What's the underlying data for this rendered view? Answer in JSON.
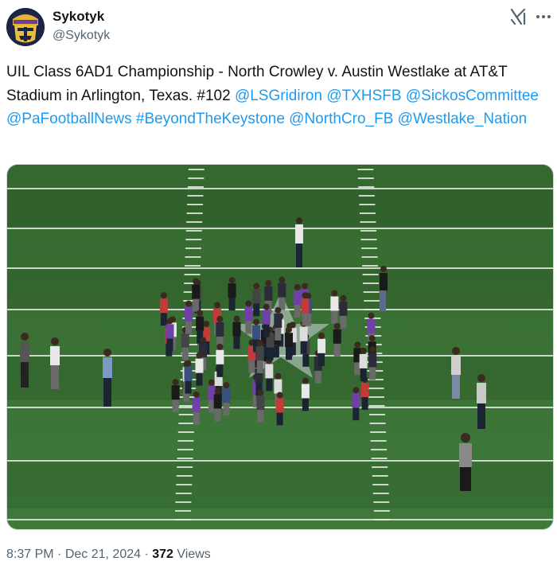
{
  "author": {
    "display_name": "Sykotyk",
    "handle": "@Sykotyk",
    "avatar_icon": "masked-face-avatar"
  },
  "tweet": {
    "text_plain": "UIL Class 6AD1 Championship - North Crowley v. Austin Westlake at AT&T Stadium in Arlington, Texas. #102 ",
    "mentions": [
      {
        "text": "@LSGridiron"
      },
      {
        "text": "@TXHSFB"
      },
      {
        "text": "@SickosCommittee"
      },
      {
        "text": "@PaFootballNews"
      },
      {
        "text": "#BeyondTheKeystone"
      },
      {
        "text": "@NorthCro_FB"
      },
      {
        "text": "@Westlake_Nation"
      }
    ]
  },
  "media": {
    "description_icon": "football-field-coin-toss-photo",
    "field_color": "#3f7a3b",
    "line_color": "#e6ece4"
  },
  "meta": {
    "time": "8:37 PM",
    "separator": "·",
    "date": "Dec 21, 2024",
    "views_count": "372",
    "views_label": "Views"
  },
  "colors": {
    "link": "#1d9bf0",
    "text": "#0f1419",
    "muted": "#536471"
  }
}
